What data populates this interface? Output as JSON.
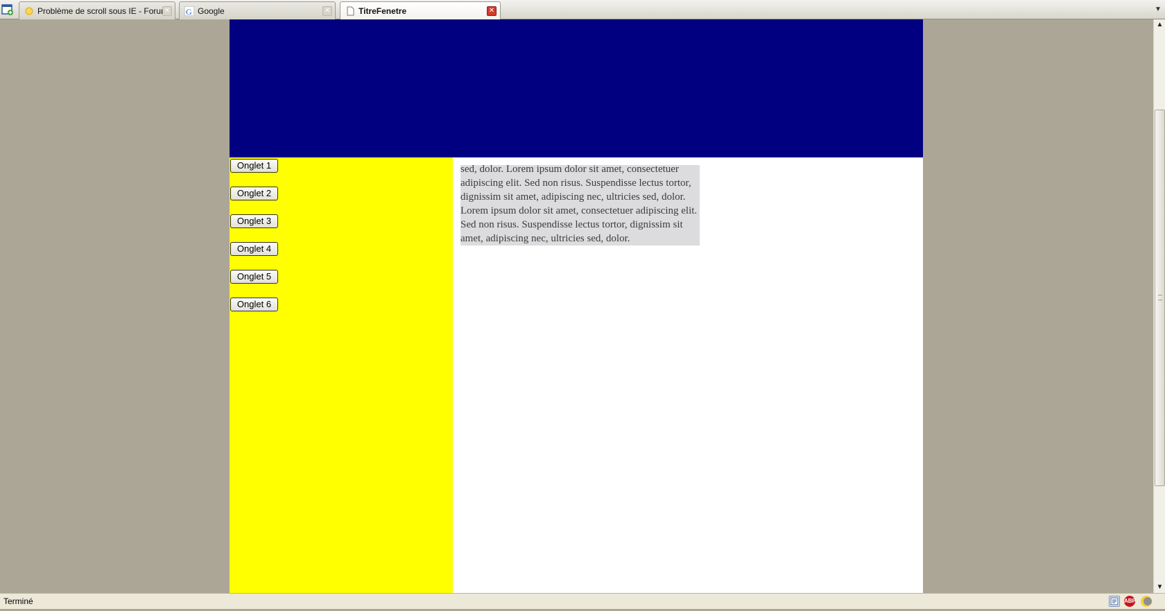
{
  "browser": {
    "tabs": [
      {
        "title": "Problème de scroll sous IE - Forum Als...",
        "favicon": "sun-icon",
        "active": false
      },
      {
        "title": "Google",
        "favicon": "google-g-icon",
        "active": false
      },
      {
        "title": "TitreFenetre",
        "favicon": "page-icon",
        "active": true
      }
    ],
    "close_glyph": "✕",
    "tab_menu_glyph": "▼"
  },
  "page": {
    "colors": {
      "banner": "#000080",
      "sidebar": "#ffff00",
      "content_box": "#dcdcdf",
      "background": "#aca697"
    },
    "onglets": [
      "Onglet 1",
      "Onglet 2",
      "Onglet 3",
      "Onglet 4",
      "Onglet 5",
      "Onglet 6"
    ],
    "content_text": "sed, dolor. Lorem ipsum dolor sit amet, consectetuer adipiscing elit. Sed non risus. Suspendisse lectus tortor, dignissim sit amet, adipiscing nec, ultricies sed, dolor. Lorem ipsum dolor sit amet, consectetuer adipiscing elit. Sed non risus. Suspendisse lectus tortor, dignissim sit amet, adipiscing nec, ultricies sed, dolor."
  },
  "scrollbar": {
    "up_glyph": "▲",
    "down_glyph": "▼",
    "position_fraction": 0.16
  },
  "statusbar": {
    "text": "Terminé",
    "icons": [
      "page-info-icon",
      "adblock-plus-icon",
      "moon-icon"
    ],
    "abp_label": "ABP"
  }
}
